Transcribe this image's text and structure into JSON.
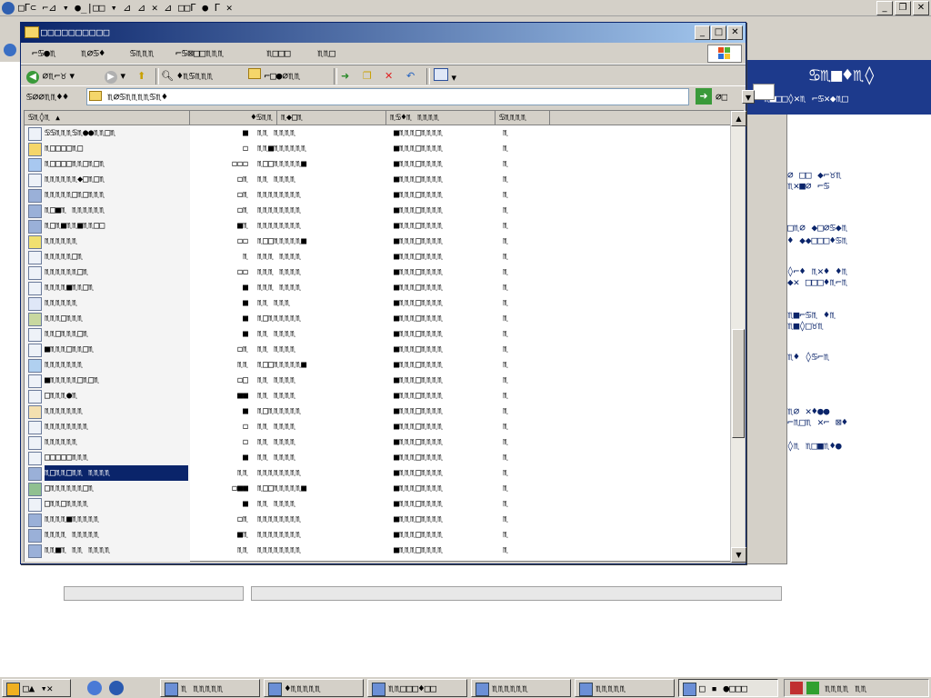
{
  "background_app": {
    "title": "□Γ⊂ ⌐⊿ ▾ ●_|□□ ▾ ⊿ ⊿ ✕ ⊿ □□Γ ● Γ ✕",
    "banner_title": "♋♏■♦♏◊",
    "banner_sub": "♏■□□◊✕♏ ⌐♋✕◆♏□",
    "side_text": [
      "⌀ □□ ◆⌐♉♏",
      "♏✕■⌀ ⌐♋",
      "□♏⌀ ◆□⌀♋◆♏",
      "♦ ◆◆□□□♦♋♏",
      "◊⌐♦ ♏✕♦ ♦♏",
      "◆✕ □□□♦♏⌐♏",
      "♏■⌐♋♏ ♦♏",
      "♏■◊□♉♏",
      "♏♦ ◊♋⌐♏",
      "♏⌀ ✕♦●●",
      "⌐♏□♏ ✕⌐ ⊠♦",
      "◊♏ ♏□■♏♦●"
    ]
  },
  "window": {
    "title": "□□□□□□□□□□",
    "menu": [
      "⌐♋●♏",
      "♏⌀♋♦",
      "♋♏♏♏",
      "⌐♋⊠□□♏♏♏",
      "♏□□□",
      "♏♏□"
    ],
    "toolbar": {
      "back": "⌀♏⌐♉",
      "search": "♦♏♋♏♏♏",
      "folders": "⌐□●⌀♏♏",
      "views_icon": "views-icon"
    },
    "address_label": "♋⌀⌀♏♏♦♦",
    "address_value": "♏⌀♋♏♏♏♏♋♏♦",
    "go_label": "⌀□",
    "columns": [
      "♋♏◊♏",
      "♦♋♏♏",
      "♏◆□♏",
      "♏♋♦♏ ♏♏♏♏",
      "♋♏♏♏♏"
    ],
    "rows": [
      {
        "name": "♋♋♏♏♏♋♏●●♏♏□♏",
        "size": "■",
        "type": "♏♏ ♏♏♏♏",
        "date": "■♏♏♏□♏♏♏♏",
        "attr": "♏",
        "icon": "doc-icon"
      },
      {
        "name": "♏□□□□♏□",
        "size": "◻",
        "type": "♏♏■♏♏♏♏♏♏",
        "date": "■♏♏♏□♏♏♏♏",
        "attr": "♏",
        "icon": "folder-icon"
      },
      {
        "name": "♏□□□□♏♏□♏□♏",
        "size": "◻◻◻",
        "type": "♏□□♏♏♏♏♏■",
        "date": "■♏♏♏□♏♏♏♏",
        "attr": "♏",
        "icon": "app-icon"
      },
      {
        "name": "♏♏♏♏♏♏◆□♏□♏",
        "size": "◻♏",
        "type": "♏♏ ♏♏♏♏",
        "date": "■♏♏♏□♏♏♏♏",
        "attr": "♏",
        "icon": "doc-icon"
      },
      {
        "name": "♏♏♏♏♏□♏□♏♏♏",
        "size": "◻♏",
        "type": "♏♏♏♏♏♏♏♏",
        "date": "■♏♏♏□♏♏♏♏",
        "attr": "♏",
        "icon": "file-icon"
      },
      {
        "name": "♏□■♏ ♏♏♏♏♏♏",
        "size": "◻♏",
        "type": "♏♏♏♏♏♏♏♏",
        "date": "■♏♏♏□♏♏♏♏",
        "attr": "♏",
        "icon": "file-icon"
      },
      {
        "name": "♏□♏■♏♏■♏♏□□",
        "size": "■♏",
        "type": "♏♏♏♏♏♏♏♏",
        "date": "■♏♏♏□♏♏♏♏",
        "attr": "♏",
        "icon": "file-icon"
      },
      {
        "name": "♏♏♏♏♏♏",
        "size": "◻◻",
        "type": "♏□□♏♏♏♏♏■",
        "date": "■♏♏♏□♏♏♏♏",
        "attr": "♏",
        "icon": "help-icon"
      },
      {
        "name": "♏♏♏♏♏□♏",
        "size": "♏",
        "type": "♏♏♏ ♏♏♏♏",
        "date": "■♏♏♏□♏♏♏♏",
        "attr": "♏",
        "icon": "doc-icon"
      },
      {
        "name": "♏♏♏♏♏♏□♏",
        "size": "◻◻",
        "type": "♏♏♏ ♏♏♏♏",
        "date": "■♏♏♏□♏♏♏♏",
        "attr": "♏",
        "icon": "doc-icon"
      },
      {
        "name": "♏♏♏♏■♏♏□♏",
        "size": "■",
        "type": "♏♏♏ ♏♏♏♏",
        "date": "■♏♏♏□♏♏♏♏",
        "attr": "♏",
        "icon": "doc-icon"
      },
      {
        "name": "♏♏♏♏♏♏",
        "size": "■",
        "type": "♏♏ ♏♏♏",
        "date": "■♏♏♏□♏♏♏♏",
        "attr": "♏",
        "icon": "window-icon"
      },
      {
        "name": "♏♏♏□♏♏♏",
        "size": "■",
        "type": "♏□♏♏♏♏♏♏",
        "date": "■♏♏♏□♏♏♏♏",
        "attr": "♏",
        "icon": "settings-icon"
      },
      {
        "name": "♏♏□♏♏♏□♏",
        "size": "■",
        "type": "♏♏ ♏♏♏♏",
        "date": "■♏♏♏□♏♏♏♏",
        "attr": "♏",
        "icon": "doc-icon"
      },
      {
        "name": "■♏♏♏□♏♏□♏",
        "size": "◻♏",
        "type": "♏♏ ♏♏♏♏",
        "date": "■♏♏♏□♏♏♏♏",
        "attr": "♏",
        "icon": "doc-icon"
      },
      {
        "name": "♏♏♏♏♏♏♏",
        "size": "♏♏",
        "type": "♏□□♏♏♏♏♏■",
        "date": "■♏♏♏□♏♏♏♏",
        "attr": "♏",
        "icon": "image-icon"
      },
      {
        "name": "■♏♏♏♏♏□♏□♏",
        "size": "◻□",
        "type": "♏♏ ♏♏♏♏",
        "date": "■♏♏♏□♏♏♏♏",
        "attr": "♏",
        "icon": "doc-icon"
      },
      {
        "name": "□♏♏♏●♏",
        "size": "■■",
        "type": "♏♏ ♏♏♏♏",
        "date": "■♏♏♏□♏♏♏♏",
        "attr": "♏",
        "icon": "doc-icon"
      },
      {
        "name": "♏♏♏♏♏♏♏",
        "size": "■",
        "type": "♏□♏♏♏♏♏♏",
        "date": "■♏♏♏□♏♏♏♏",
        "attr": "♏",
        "icon": "script-icon"
      },
      {
        "name": "♏♏♏♏♏♏♏♏",
        "size": "◻",
        "type": "♏♏ ♏♏♏♏",
        "date": "■♏♏♏□♏♏♏♏",
        "attr": "♏",
        "icon": "doc-icon"
      },
      {
        "name": "♏♏♏♏♏♏",
        "size": "◻",
        "type": "♏♏ ♏♏♏♏",
        "date": "■♏♏♏□♏♏♏♏",
        "attr": "♏",
        "icon": "doc-icon"
      },
      {
        "name": "□□□□□♏♏♏",
        "size": "■",
        "type": "♏♏ ♏♏♏♏",
        "date": "■♏♏♏□♏♏♏♏",
        "attr": "♏",
        "icon": "doc-icon"
      },
      {
        "name": "♏□♏♏□♏♏ ♏♏♏♏",
        "size": "♏♏",
        "type": "♏♏♏♏♏♏♏♏",
        "date": "■♏♏♏□♏♏♏♏",
        "attr": "♏",
        "icon": "file-icon",
        "selected": true
      },
      {
        "name": "□♏♏♏♏♏♏□♏",
        "size": "◻■■",
        "type": "♏□□♏♏♏♏♏■",
        "date": "■♏♏♏□♏♏♏♏",
        "attr": "♏",
        "icon": "setup-icon"
      },
      {
        "name": "□♏♏□♏♏♏♏",
        "size": "■",
        "type": "♏♏ ♏♏♏♏",
        "date": "■♏♏♏□♏♏♏♏",
        "attr": "♏",
        "icon": "doc-icon"
      },
      {
        "name": "♏♏♏♏■♏♏♏♏♏",
        "size": "◻♏",
        "type": "♏♏♏♏♏♏♏♏",
        "date": "■♏♏♏□♏♏♏♏",
        "attr": "♏",
        "icon": "file-icon"
      },
      {
        "name": "♏♏♏♏ ♏♏♏♏♏",
        "size": "■♏",
        "type": "♏♏♏♏♏♏♏♏",
        "date": "■♏♏♏□♏♏♏♏",
        "attr": "♏",
        "icon": "file-icon"
      },
      {
        "name": "♏♏■♏ ♏♏ ♏♏♏♏",
        "size": "♏♏",
        "type": "♏♏♏♏♏♏♏♏",
        "date": "■♏♏♏□♏♏♏♏",
        "attr": "♏",
        "icon": "file-icon"
      }
    ]
  },
  "taskbar": {
    "start_label": "□▲ ▾✕",
    "tasks": [
      {
        "label": "♏ ♏♏♏♏♏",
        "icon": "window-icon"
      },
      {
        "label": "♦♏♏♏♏♏",
        "icon": "app-icon"
      },
      {
        "label": "♏♏□□□♦□□",
        "icon": "tool-icon"
      },
      {
        "label": "♏♏♏♏♏♏",
        "icon": "box-icon"
      },
      {
        "label": "♏♏♏♏♏",
        "icon": "help-icon"
      },
      {
        "label": "□ ▪ ●□□□",
        "icon": "folder-icon",
        "active": true
      }
    ],
    "tray_text": "♏♏♏♏ ♏♏"
  },
  "colors": {
    "title_active_start": "#0a246a",
    "title_active_end": "#a6caf0",
    "selection": "#0a246a",
    "face": "#d4d0c8"
  }
}
